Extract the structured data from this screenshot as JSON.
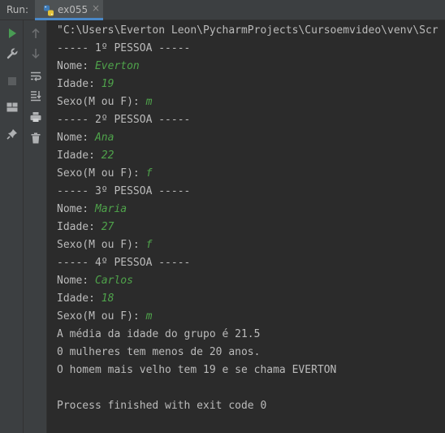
{
  "run_panel": {
    "run_label": "Run:",
    "tab": {
      "label": "ex055",
      "close": "×",
      "icon": "python-file-icon"
    }
  },
  "toolbar": {
    "left": [
      "rerun-icon",
      "wrench-icon",
      "stop-icon",
      "layout-icon",
      "pin-icon"
    ],
    "right": [
      "scroll-up-icon",
      "scroll-down-icon",
      "soft-wrap-icon",
      "scroll-to-end-icon",
      "print-icon",
      "trash-icon"
    ]
  },
  "colors": {
    "input_text": "#4fa34b",
    "output_text": "#bbbbbb",
    "background": "#2b2b2b",
    "accent": "#4a88c7"
  },
  "console": {
    "command": "\"C:\\Users\\Everton Leon\\PycharmProjects\\Cursoemvideo\\venv\\Scr",
    "people": [
      {
        "header": "----- 1º PESSOA -----",
        "nome_label": "Nome: ",
        "nome": "Everton",
        "idade_label": "Idade: ",
        "idade": "19",
        "sexo_label": "Sexo(M ou F): ",
        "sexo": "m"
      },
      {
        "header": "----- 2º PESSOA -----",
        "nome_label": "Nome: ",
        "nome": "Ana",
        "idade_label": "Idade: ",
        "idade": "22",
        "sexo_label": "Sexo(M ou F): ",
        "sexo": "f"
      },
      {
        "header": "----- 3º PESSOA -----",
        "nome_label": "Nome: ",
        "nome": "Maria",
        "idade_label": "Idade: ",
        "idade": "27",
        "sexo_label": "Sexo(M ou F): ",
        "sexo": "f"
      },
      {
        "header": "----- 4º PESSOA -----",
        "nome_label": "Nome: ",
        "nome": "Carlos",
        "idade_label": "Idade: ",
        "idade": "18",
        "sexo_label": "Sexo(M ou F): ",
        "sexo": "m"
      }
    ],
    "result_media": "A média da idade do grupo é 21.5",
    "result_mulheres": "0 mulheres tem menos de 20 anos.",
    "result_homem": "O homem mais velho tem 19 e se chama EVERTON",
    "exit_message": "Process finished with exit code 0"
  }
}
